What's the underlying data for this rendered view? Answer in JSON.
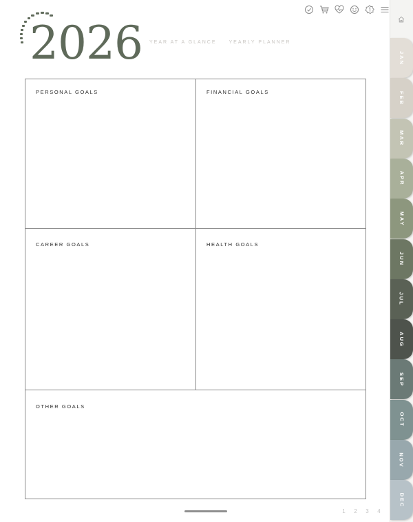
{
  "header": {
    "year": "2026",
    "links": [
      {
        "label": "YEAR AT A GLANCE"
      },
      {
        "label": "YEARLY PLANNER"
      }
    ],
    "toolbar_icons": [
      "check-circle-icon",
      "cart-icon",
      "heart-pulse-icon",
      "smiley-icon",
      "badge-one-icon",
      "menu-icon"
    ]
  },
  "goals": {
    "personal": "PERSONAL GOALS",
    "financial": "FINANCIAL GOALS",
    "career": "CAREER GOALS",
    "health": "HEALTH GOALS",
    "other": "OTHER GOALS"
  },
  "footer": {
    "pages": [
      "1",
      "2",
      "3",
      "4"
    ]
  },
  "sidebar": {
    "home_icon": "home-icon",
    "tabs": [
      {
        "label": "JAN",
        "color": "#e3ded7"
      },
      {
        "label": "FEB",
        "color": "#d6d1c8"
      },
      {
        "label": "MAR",
        "color": "#c3c4b4"
      },
      {
        "label": "APR",
        "color": "#a9b09a"
      },
      {
        "label": "MAY",
        "color": "#8d977e"
      },
      {
        "label": "JUN",
        "color": "#6d7763"
      },
      {
        "label": "JUL",
        "color": "#5a6155"
      },
      {
        "label": "AUG",
        "color": "#4e534c"
      },
      {
        "label": "SEP",
        "color": "#6b7a76"
      },
      {
        "label": "OCT",
        "color": "#7f9291"
      },
      {
        "label": "NOV",
        "color": "#98a8ad"
      },
      {
        "label": "DEC",
        "color": "#b7c2c8"
      }
    ]
  },
  "colors": {
    "year": "#5f6a5a",
    "grid_border": "#8a8a8a",
    "link": "#c9c6c2"
  }
}
